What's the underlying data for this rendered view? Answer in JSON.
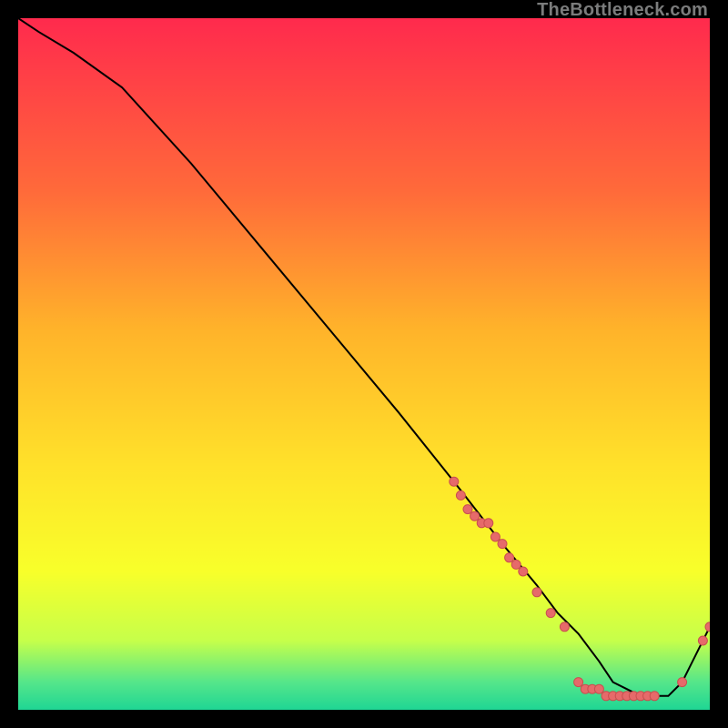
{
  "watermark": "TheBottleneck.com",
  "colors": {
    "gradient_top": "#ff2a4d",
    "gradient_mid1": "#ff6a3a",
    "gradient_mid2": "#ffb32a",
    "gradient_mid3": "#ffe22a",
    "gradient_mid4": "#f8ff2a",
    "gradient_bottom1": "#c6ff4a",
    "gradient_bottom2": "#55e68a",
    "gradient_bottom3": "#1fd694",
    "line": "#000000",
    "point_fill": "#e66a6a",
    "point_stroke": "#c94f4f",
    "background": "#000000"
  },
  "chart_data": {
    "type": "line",
    "title": "",
    "xlabel": "",
    "ylabel": "",
    "xlim": [
      0,
      100
    ],
    "ylim": [
      0,
      100
    ],
    "series": [
      {
        "name": "curve",
        "x": [
          0,
          3,
          8,
          15,
          25,
          35,
          45,
          55,
          63,
          70,
          75,
          78,
          81,
          84,
          86,
          88,
          90,
          92,
          94,
          96,
          98,
          100
        ],
        "y": [
          100,
          98,
          95,
          90,
          79,
          67,
          55,
          43,
          33,
          24,
          18,
          14,
          11,
          7,
          4,
          3,
          2,
          2,
          2,
          4,
          8,
          12
        ]
      }
    ],
    "points": [
      {
        "x": 63,
        "y": 33
      },
      {
        "x": 64,
        "y": 31
      },
      {
        "x": 65,
        "y": 29
      },
      {
        "x": 66,
        "y": 28
      },
      {
        "x": 67,
        "y": 27
      },
      {
        "x": 68,
        "y": 27
      },
      {
        "x": 69,
        "y": 25
      },
      {
        "x": 70,
        "y": 24
      },
      {
        "x": 71,
        "y": 22
      },
      {
        "x": 72,
        "y": 21
      },
      {
        "x": 73,
        "y": 20
      },
      {
        "x": 75,
        "y": 17
      },
      {
        "x": 77,
        "y": 14
      },
      {
        "x": 79,
        "y": 12
      },
      {
        "x": 81,
        "y": 4
      },
      {
        "x": 82,
        "y": 3
      },
      {
        "x": 83,
        "y": 3
      },
      {
        "x": 84,
        "y": 3
      },
      {
        "x": 85,
        "y": 2
      },
      {
        "x": 86,
        "y": 2
      },
      {
        "x": 87,
        "y": 2
      },
      {
        "x": 88,
        "y": 2
      },
      {
        "x": 89,
        "y": 2
      },
      {
        "x": 90,
        "y": 2
      },
      {
        "x": 91,
        "y": 2
      },
      {
        "x": 92,
        "y": 2
      },
      {
        "x": 96,
        "y": 4
      },
      {
        "x": 99,
        "y": 10
      },
      {
        "x": 100,
        "y": 12
      }
    ]
  }
}
